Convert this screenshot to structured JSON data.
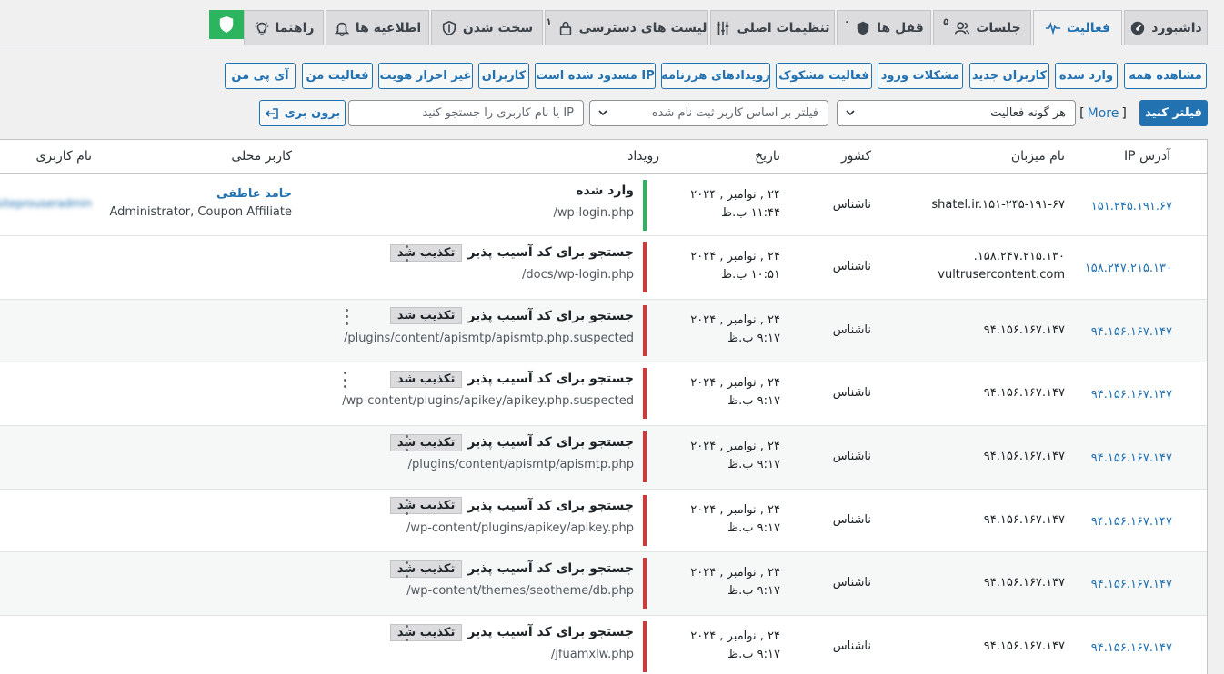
{
  "tabs": [
    {
      "label": "داشبورد",
      "icon": "dashboard-icon"
    },
    {
      "label": "فعالیت",
      "icon": "activity-pulse-icon",
      "active": true
    },
    {
      "label": "جلسات",
      "count": "۵",
      "icon": "users-icon"
    },
    {
      "label": "قفل ها",
      "count": "۰",
      "icon": "shield-filled-icon"
    },
    {
      "label": "تنظیمات اصلی",
      "icon": "sliders-icon"
    },
    {
      "label": "لیست های دسترسی",
      "count": "۱",
      "icon": "lock-icon"
    },
    {
      "label": "سخت شدن",
      "icon": "shield-check-icon"
    },
    {
      "label": "اطلاعیه ها",
      "icon": "bell-icon"
    },
    {
      "label": "راهنما",
      "icon": "lightbulb-icon"
    }
  ],
  "filters": [
    "مشاهده همه",
    "وارد شده",
    "کاربران جدید",
    "مشکلات ورود",
    "فعالیت مشکوک",
    "رویدادهای هرزنامه",
    "IP مسدود شده است",
    "کاربران",
    "غیر احراز هویت",
    "فعالیت من",
    "آی پی من"
  ],
  "search": {
    "submit_label": "فیلتر کنید",
    "more_label": "More",
    "activity_type": "هر گونه فعالیت",
    "user_filter_placeholder": "فیلتر بر اساس کاربر ثبت نام شده",
    "ip_search_placeholder": "IP یا نام کاربری را جستجو کنید",
    "logout_label": "برون بری"
  },
  "table": {
    "headers": {
      "ip": "آدرس IP",
      "host": "نام میزبان",
      "country": "کشور",
      "date": "تاریخ",
      "event": "رویداد",
      "local_user": "کاربر محلی",
      "username": "نام کاربری"
    },
    "rows": [
      {
        "ip": "۱۵۱.۲۴۵.۱۹۱.۶۷",
        "host": [
          "shatel.ir.۱۵۱-۲۴۵-۱۹۱-۶۷"
        ],
        "country": "ناشناس",
        "date": "۲۴ , نوامبر , ۲۰۲۴",
        "time": "۱۱:۴۴ ب.ظ",
        "event": "وارد شده",
        "badge": "",
        "path": "/wp-login.php",
        "status": "ok",
        "local_user": "حامد عاطفی",
        "role": "Administrator, Coupon Affiliate",
        "username": "siteprouseradmin"
      },
      {
        "ip": "۱۵۸.۲۴۷.۲۱۵.۱۳۰",
        "host": [
          "۱۵۸.۲۴۷.۲۱۵.۱۳۰.",
          "vultrusercontent.com"
        ],
        "country": "ناشناس",
        "date": "۲۴ , نوامبر , ۲۰۲۴",
        "time": "۱۰:۵۱ ب.ظ",
        "event": "جستجو برای کد آسیب پذیر",
        "badge": "تکذیب شد",
        "path": "/docs/wp-login.php",
        "status": "blocked"
      },
      {
        "ip": "۹۴.۱۵۶.۱۶۷.۱۴۷",
        "host": [
          "۹۴.۱۵۶.۱۶۷.۱۴۷"
        ],
        "country": "ناشناس",
        "date": "۲۴ , نوامبر , ۲۰۲۴",
        "time": "۹:۱۷ ب.ظ",
        "event": "جستجو برای کد آسیب پذیر",
        "badge": "تکذیب شد",
        "path": "/plugins/content/apismtp/apismtp.php.suspected",
        "status": "blocked"
      },
      {
        "ip": "۹۴.۱۵۶.۱۶۷.۱۴۷",
        "host": [
          "۹۴.۱۵۶.۱۶۷.۱۴۷"
        ],
        "country": "ناشناس",
        "date": "۲۴ , نوامبر , ۲۰۲۴",
        "time": "۹:۱۷ ب.ظ",
        "event": "جستجو برای کد آسیب پذیر",
        "badge": "تکذیب شد",
        "path": "/wp-content/plugins/apikey/apikey.php.suspected",
        "status": "blocked"
      },
      {
        "ip": "۹۴.۱۵۶.۱۶۷.۱۴۷",
        "host": [
          "۹۴.۱۵۶.۱۶۷.۱۴۷"
        ],
        "country": "ناشناس",
        "date": "۲۴ , نوامبر , ۲۰۲۴",
        "time": "۹:۱۷ ب.ظ",
        "event": "جستجو برای کد آسیب پذیر",
        "badge": "تکذیب شد",
        "path": "/plugins/content/apismtp/apismtp.php",
        "status": "blocked"
      },
      {
        "ip": "۹۴.۱۵۶.۱۶۷.۱۴۷",
        "host": [
          "۹۴.۱۵۶.۱۶۷.۱۴۷"
        ],
        "country": "ناشناس",
        "date": "۲۴ , نوامبر , ۲۰۲۴",
        "time": "۹:۱۷ ب.ظ",
        "event": "جستجو برای کد آسیب پذیر",
        "badge": "تکذیب شد",
        "path": "/wp-content/plugins/apikey/apikey.php",
        "status": "blocked"
      },
      {
        "ip": "۹۴.۱۵۶.۱۶۷.۱۴۷",
        "host": [
          "۹۴.۱۵۶.۱۶۷.۱۴۷"
        ],
        "country": "ناشناس",
        "date": "۲۴ , نوامبر , ۲۰۲۴",
        "time": "۹:۱۷ ب.ظ",
        "event": "جستجو برای کد آسیب پذیر",
        "badge": "تکذیب شد",
        "path": "/wp-content/themes/seotheme/db.php",
        "status": "blocked"
      },
      {
        "ip": "۹۴.۱۵۶.۱۶۷.۱۴۷",
        "host": [
          "۹۴.۱۵۶.۱۶۷.۱۴۷"
        ],
        "country": "ناشناس",
        "date": "۲۴ , نوامبر , ۲۰۲۴",
        "time": "۹:۱۷ ب.ظ",
        "event": "جستجو برای کد آسیب پذیر",
        "badge": "تکذیب شد",
        "path": "/jfuamxlw.php",
        "status": "blocked"
      }
    ]
  },
  "colors": {
    "accent": "#2271b1",
    "danger": "#d63638",
    "success": "#2cb55e"
  }
}
